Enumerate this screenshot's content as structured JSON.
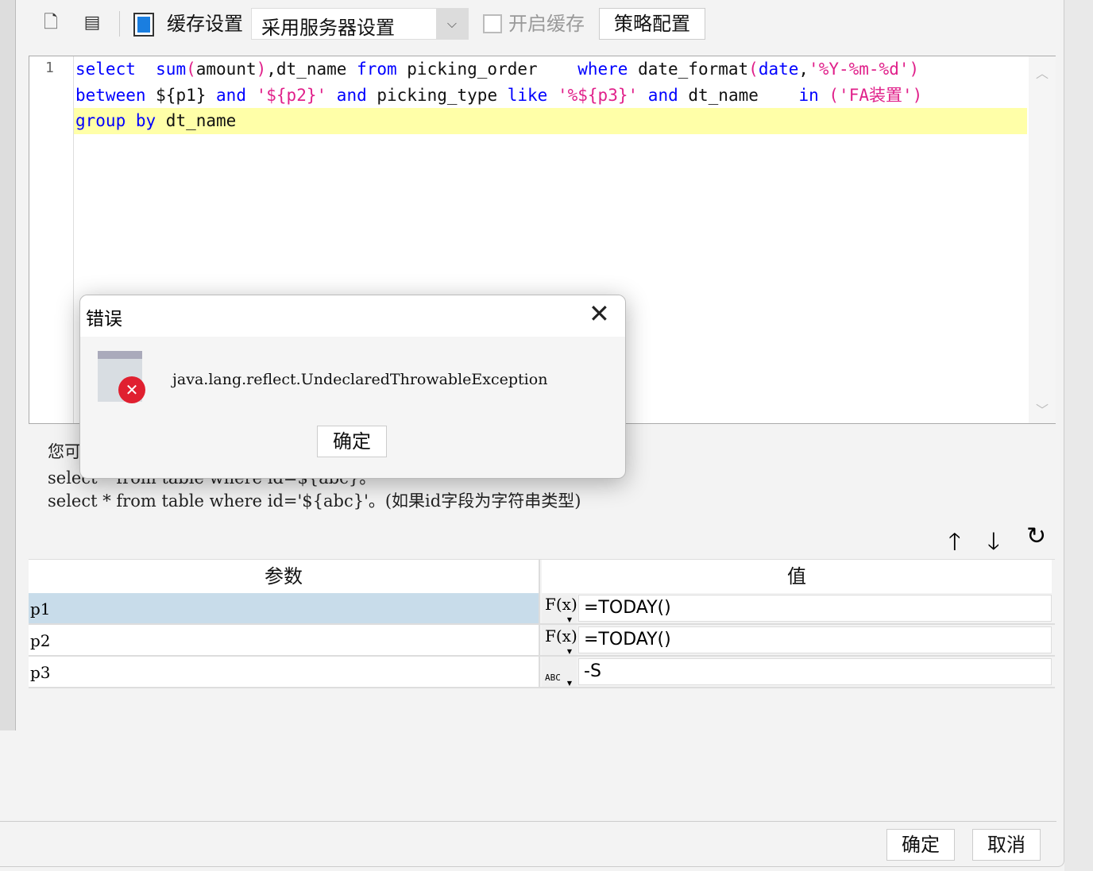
{
  "toolbar": {
    "cache_settings_label": "缓存设置",
    "cache_mode": "采用服务器设置",
    "enable_cache_label": "开启缓存",
    "enable_cache_checked": false,
    "strategy_button": "策略配置"
  },
  "editor": {
    "line_numbers": [
      "1"
    ],
    "lines": [
      [
        [
          "kw",
          "select"
        ],
        [
          "",
          "  "
        ],
        [
          "kw",
          "sum"
        ],
        [
          "str",
          "("
        ],
        [
          "",
          "amount"
        ],
        [
          "str",
          ")"
        ],
        [
          "",
          ",dt_name "
        ],
        [
          "kw",
          "from"
        ],
        [
          "",
          " picking_order    "
        ],
        [
          "kw",
          "where"
        ],
        [
          "",
          " date_format"
        ],
        [
          "str",
          "("
        ],
        [
          "kw",
          "date"
        ],
        [
          "",
          ","
        ],
        [
          "str",
          "'%Y-%m-%d')"
        ]
      ],
      [
        [
          "kw",
          "between"
        ],
        [
          "",
          " ${p1} "
        ],
        [
          "kw",
          "and"
        ],
        [
          "",
          " "
        ],
        [
          "str",
          "'${p2}'"
        ],
        [
          "",
          " "
        ],
        [
          "kw",
          "and"
        ],
        [
          "",
          " picking_type "
        ],
        [
          "kw",
          "like"
        ],
        [
          "",
          " "
        ],
        [
          "str",
          "'%${p3}'"
        ],
        [
          "",
          " "
        ],
        [
          "kw",
          "and"
        ],
        [
          "",
          " dt_name    "
        ],
        [
          "kw",
          "in"
        ],
        [
          "",
          " "
        ],
        [
          "str",
          "('FA装置')"
        ]
      ],
      [
        [
          "kw",
          "group by"
        ],
        [
          "",
          " dt_name"
        ]
      ]
    ]
  },
  "hint": {
    "line0": "您可",
    "line1": "select * from table where id=${abc}。",
    "line2": "select * from table where id='${abc}'。(如果id字段为字符串类型)"
  },
  "param_table": {
    "headers": [
      "参数",
      "值"
    ],
    "rows": [
      {
        "name": "p1",
        "type_icon": "formula-icon",
        "type_text": "F(x)",
        "value": "=TODAY()",
        "selected": true
      },
      {
        "name": "p2",
        "type_icon": "formula-icon",
        "type_text": "F(x)",
        "value": "=TODAY()",
        "selected": false
      },
      {
        "name": "p3",
        "type_icon": "text-type-icon",
        "type_text": "ABC",
        "value": "-S",
        "selected": false
      }
    ]
  },
  "dialog": {
    "title": "错误",
    "message": "java.lang.reflect.UndeclaredThrowableException",
    "ok_button": "确定"
  },
  "footer": {
    "ok_button": "确定",
    "cancel_button": "取消"
  },
  "colors": {
    "keyword": "#0000ff",
    "string": "#e0208a",
    "highlight": "#ffffa8",
    "selected_row": "#c8dcea",
    "error": "#e02030"
  }
}
